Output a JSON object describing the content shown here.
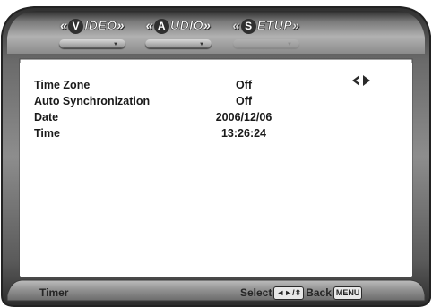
{
  "tabs": [
    {
      "first": "V",
      "rest": "IDEO",
      "active": false
    },
    {
      "first": "A",
      "rest": "UDIO",
      "active": false
    },
    {
      "first": "S",
      "rest": "ETUP",
      "active": true
    }
  ],
  "settings": [
    {
      "label": "Time Zone",
      "value": "Off"
    },
    {
      "label": "Auto Synchronization",
      "value": "Off"
    },
    {
      "label": "Date",
      "value": "2006/12/06"
    },
    {
      "label": "Time",
      "value": "13:26:24"
    }
  ],
  "footer": {
    "page_name": "Timer",
    "select_label": "Select",
    "select_keys": "◄►/⬍",
    "back_label": "Back",
    "back_key": "MENU"
  },
  "colors": {
    "frame_dark": "#3b3b3b",
    "frame_light": "#cfcfcf",
    "panel": "#ffffff"
  },
  "icons": {
    "row_selector": "left-right-arrows-icon"
  }
}
